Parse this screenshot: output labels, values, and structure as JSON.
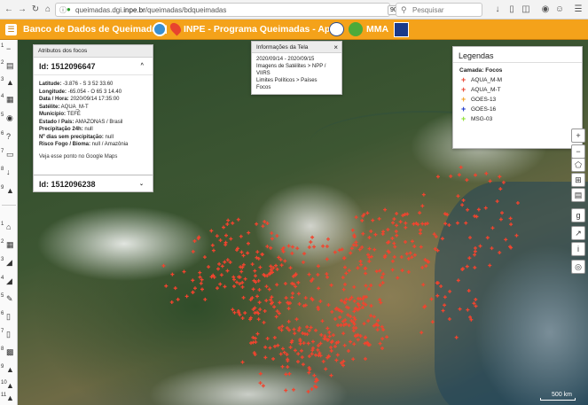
{
  "browser": {
    "url_prefix": "queimadas.dgi.",
    "url_domain": "inpe.br",
    "url_path": "/queimadas/bdqueimadas",
    "zoom": "90%",
    "search_placeholder": "Pesquisar",
    "icons": [
      "back-icon",
      "forward-icon",
      "reload-icon",
      "home-icon",
      "info-icon",
      "bookmark-star-icon",
      "search-icon",
      "download-icon",
      "library-icon",
      "menu-icon"
    ]
  },
  "header": {
    "title": "Banco de Dados de Queimadas |",
    "inpe_title": "INPE - Programa Queimadas - Apoio",
    "mma": "MMA",
    "background": "#f4a21a"
  },
  "toolbar": {
    "group1": [
      {
        "num": "1",
        "icon": "share-icon"
      },
      {
        "num": "2",
        "icon": "chart-icon"
      },
      {
        "num": "3",
        "icon": "user-icon"
      },
      {
        "num": "4",
        "icon": "calendar-icon"
      },
      {
        "num": "5",
        "icon": "camera-icon"
      },
      {
        "num": "6",
        "icon": "help-icon"
      },
      {
        "num": "7",
        "icon": "screen-icon"
      },
      {
        "num": "8",
        "icon": "download-icon"
      },
      {
        "num": "9",
        "icon": "warning-icon"
      }
    ],
    "group2": [
      {
        "num": "1",
        "icon": "home-icon"
      },
      {
        "num": "2",
        "icon": "table-icon"
      },
      {
        "num": "3",
        "icon": "area-chart-icon"
      },
      {
        "num": "4",
        "icon": "satellite-icon"
      },
      {
        "num": "5",
        "icon": "edit-icon"
      },
      {
        "num": "6",
        "icon": "document-icon"
      },
      {
        "num": "7",
        "icon": "document-icon"
      },
      {
        "num": "8",
        "icon": "clipboard-icon"
      },
      {
        "num": "9",
        "icon": "fire-icon"
      },
      {
        "num": "10",
        "icon": "fire-icon"
      },
      {
        "num": "11",
        "icon": "fire-icon"
      }
    ]
  },
  "attributes": {
    "title": "Atributos dos focos",
    "id1": "Id: 1512096647",
    "lines": [
      {
        "label": "Latitude:",
        "value": " -3.876 - S 3 52 33.60"
      },
      {
        "label": "Longitude:",
        "value": " -65.054 - O 65 3 14.40"
      },
      {
        "label": "Data / Hora:",
        "value": " 2020/09/14 17:35:00"
      },
      {
        "label": "Satélite:",
        "value": " AQUA_M-T"
      },
      {
        "label": "Município:",
        "value": " TEFÉ"
      },
      {
        "label": "Estado / País:",
        "value": " AMAZONAS / Brasil"
      },
      {
        "label": "Precipitação 24h:",
        "value": " null"
      },
      {
        "label": "Nº dias sem precipitação:",
        "value": " null"
      },
      {
        "label": "Risco Fogo / Bioma:",
        "value": " null / Amazônia"
      }
    ],
    "link": "Veja esse ponto no Google Maps",
    "id2": "Id: 1512096238"
  },
  "info": {
    "title": "Informações da Tela",
    "lines": [
      "2020/09/14 - 2020/09/15",
      "Imagens de Satélites > NPP / VIIRS",
      "Limites Políticos > Países",
      "Focos"
    ]
  },
  "legend": {
    "title": "Legendas",
    "layer": "Camada: Focos",
    "items": [
      {
        "label": "AQUA_M-M",
        "color": "#e8432e"
      },
      {
        "label": "AQUA_M-T",
        "color": "#e8432e"
      },
      {
        "label": "GOES-13",
        "color": "#f0a020"
      },
      {
        "label": "GOES-16",
        "color": "#1530c8"
      },
      {
        "label": "MSG-03",
        "color": "#8adf2a"
      }
    ]
  },
  "map": {
    "scale": "500 km",
    "hotspot_color": "#f2442e",
    "controls": [
      "zoom-in-icon",
      "zoom-out-icon",
      "polygon-icon",
      "crop-icon",
      "layers-icon",
      "google-icon",
      "graph-icon",
      "info-icon",
      "locate-icon"
    ]
  }
}
